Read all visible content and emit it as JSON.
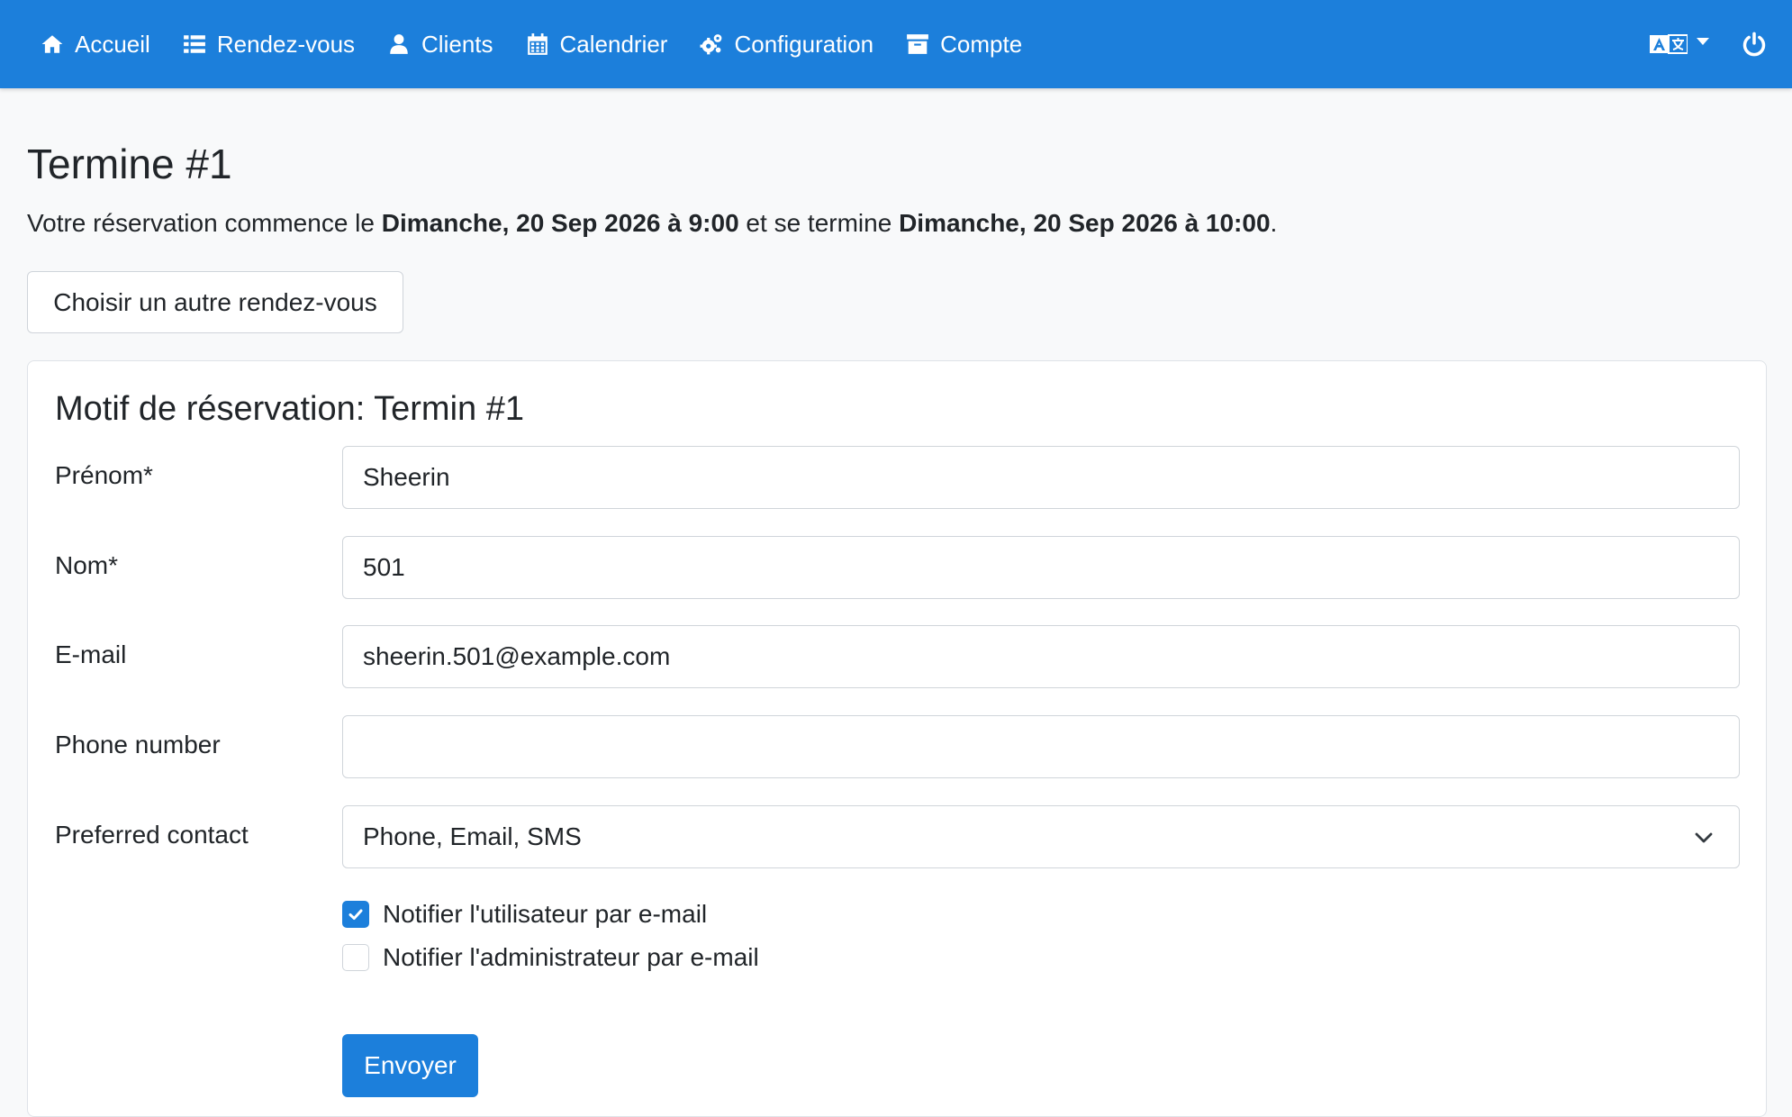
{
  "nav": {
    "items": [
      {
        "label": "Accueil",
        "icon": "home-icon"
      },
      {
        "label": "Rendez-vous",
        "icon": "list-icon"
      },
      {
        "label": "Clients",
        "icon": "user-icon"
      },
      {
        "label": "Calendrier",
        "icon": "calendar-icon"
      },
      {
        "label": "Configuration",
        "icon": "gears-icon"
      },
      {
        "label": "Compte",
        "icon": "archive-icon"
      }
    ],
    "language_icon": "translate-icon",
    "logout_icon": "power-icon"
  },
  "page": {
    "title": "Termine #1",
    "info_prefix": "Votre réservation commence le ",
    "start": "Dimanche, 20 Sep 2026 à 9:00",
    "info_middle": " et se termine ",
    "end": "Dimanche, 20 Sep 2026 à 10:00",
    "info_suffix": ".",
    "other_button": "Choisir un autre rendez-vous"
  },
  "form": {
    "title": "Motif de réservation: Termin #1",
    "first_name": {
      "label": "Prénom*",
      "value": "Sheerin"
    },
    "last_name": {
      "label": "Nom*",
      "value": "501"
    },
    "email": {
      "label": "E-mail",
      "value": "sheerin.501@example.com"
    },
    "phone": {
      "label": "Phone number",
      "value": ""
    },
    "preferred": {
      "label": "Preferred contact",
      "value": "Phone, Email, SMS"
    },
    "notify_user": {
      "label": "Notifier l'utilisateur par e-mail",
      "checked": true
    },
    "notify_admin": {
      "label": "Notifier l'administrateur par e-mail",
      "checked": false
    },
    "submit": "Envoyer"
  },
  "colors": {
    "primary": "#1c7fdb",
    "background": "#f8f9fa",
    "text": "#212529"
  }
}
